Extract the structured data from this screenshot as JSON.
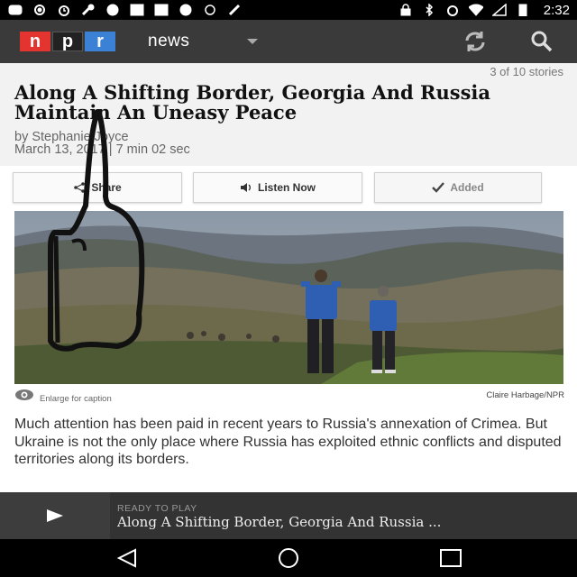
{
  "status_bar": {
    "time": "2:32",
    "icons": [
      "messages-icon",
      "notification-dot-icon",
      "alarm-icon",
      "wrench-icon",
      "emoji-icon",
      "facebook-icon",
      "facebook-icon",
      "emoji-icon",
      "info-icon",
      "no-sim-icon",
      "lock-icon",
      "bluetooth-icon",
      "alarm-icon",
      "wifi-icon",
      "signal-off-icon",
      "battery-charging-icon"
    ]
  },
  "app_bar": {
    "logo_letters": [
      "n",
      "p",
      "r"
    ],
    "section": "news",
    "refresh_icon": "refresh-icon",
    "search_icon": "search-icon",
    "colors": {
      "background": "#3a3a3a",
      "logo_n": "#e3342f",
      "logo_p": "#222222",
      "logo_r": "#3b82d6"
    }
  },
  "article": {
    "story_position": "3 of 10 stories",
    "headline": "Along A Shifting Border, Georgia And Russia Maintain An Uneasy Peace",
    "author": "by Stephanie Joyce",
    "meta": "March 13, 2017 | 7 min 02 sec",
    "actions": {
      "share": "Share",
      "listen": "Listen Now",
      "added": "Added"
    },
    "image_caption": {
      "enlarge": "Enlarge for caption",
      "credit": "Claire Harbage/NPR"
    },
    "body": "Much attention has been paid in recent years to Russia's annexation of Crimea. But Ukraine is not the only place where Russia has exploited ethnic conflicts and disputed territories along its borders."
  },
  "player": {
    "label": "READY TO PLAY",
    "title": "Along A Shifting Border, Georgia And Russia ..."
  },
  "nav_bar": {
    "buttons": [
      "back-icon",
      "home-icon",
      "recent-apps-icon"
    ]
  }
}
